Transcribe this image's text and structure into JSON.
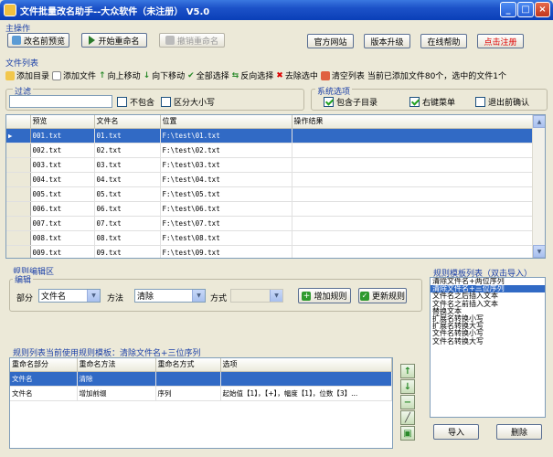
{
  "window": {
    "title": "文件批量改名助手--大众软件（未注册） V5.0"
  },
  "main_ops": {
    "label": "主操作",
    "preview": "改名前预览",
    "start": "开始重命名",
    "undo": "撤销重命名",
    "website": "官方网站",
    "upgrade": "版本升级",
    "help": "在线帮助",
    "register": "点击注册"
  },
  "file_list": {
    "label": "文件列表",
    "toolbar": {
      "add_dir": "添加目录",
      "add_file": "添加文件",
      "move_up": "向上移动",
      "move_down": "向下移动",
      "select_all": "全部选择",
      "invert": "反向选择",
      "remove": "去除选中",
      "clear": "清空列表",
      "status": "当前已添加文件80个，选中的文件1个"
    },
    "columns": [
      "预览",
      "文件名",
      "位置",
      "操作结果"
    ],
    "rows": [
      [
        "001.txt",
        "01.txt",
        "F:\\test\\01.txt",
        ""
      ],
      [
        "002.txt",
        "02.txt",
        "F:\\test\\02.txt",
        ""
      ],
      [
        "003.txt",
        "03.txt",
        "F:\\test\\03.txt",
        ""
      ],
      [
        "004.txt",
        "04.txt",
        "F:\\test\\04.txt",
        ""
      ],
      [
        "005.txt",
        "05.txt",
        "F:\\test\\05.txt",
        ""
      ],
      [
        "006.txt",
        "06.txt",
        "F:\\test\\06.txt",
        ""
      ],
      [
        "007.txt",
        "07.txt",
        "F:\\test\\07.txt",
        ""
      ],
      [
        "008.txt",
        "08.txt",
        "F:\\test\\08.txt",
        ""
      ],
      [
        "009.txt",
        "09.txt",
        "F:\\test\\09.txt",
        ""
      ]
    ]
  },
  "filter": {
    "label": "过滤",
    "value": "",
    "not_contain": "不包含",
    "case_sensitive": "区分大小写"
  },
  "sys_options": {
    "label": "系统选项",
    "include_subdir": "包含子目录",
    "context_menu": "右键菜单",
    "exit_confirm": "退出前确认"
  },
  "rule_edit": {
    "label": "规则编辑区",
    "edit_label": "编辑",
    "part_label": "部分",
    "part_value": "文件名",
    "method_label": "方法",
    "method_value": "清除",
    "mode_label": "方式",
    "mode_value": "",
    "add_rule": "增加规则",
    "update_rule": "更新规则"
  },
  "rules_list": {
    "label": "规则列表当前使用规则模板：清除文件名+三位序列",
    "columns": [
      "重命名部分",
      "重命名方法",
      "重命名方式",
      "选项"
    ],
    "rows": [
      [
        "文件名",
        "清除",
        "",
        ""
      ],
      [
        "文件名",
        "增加前缀",
        "序列",
        "起始值【1】，【+】，幅度【1】，位数【3】..."
      ]
    ]
  },
  "templates": {
    "label": "规则模板列表（双击导入）",
    "items": [
      "清除文件名+两位序列",
      "清除文件名+三位序列",
      "文件名之后插入文本",
      "文件名之前插入文本",
      "替换文本",
      "扩展名转换小写",
      "扩展名转换大写",
      "文件名转换小写",
      "文件名转换大写"
    ],
    "selected_index": 1,
    "import": "导入",
    "delete": "删除"
  },
  "colors": {
    "accent": "#316ac5",
    "titlebar": "#0a3fb8",
    "group_label": "#1a3fa8"
  }
}
